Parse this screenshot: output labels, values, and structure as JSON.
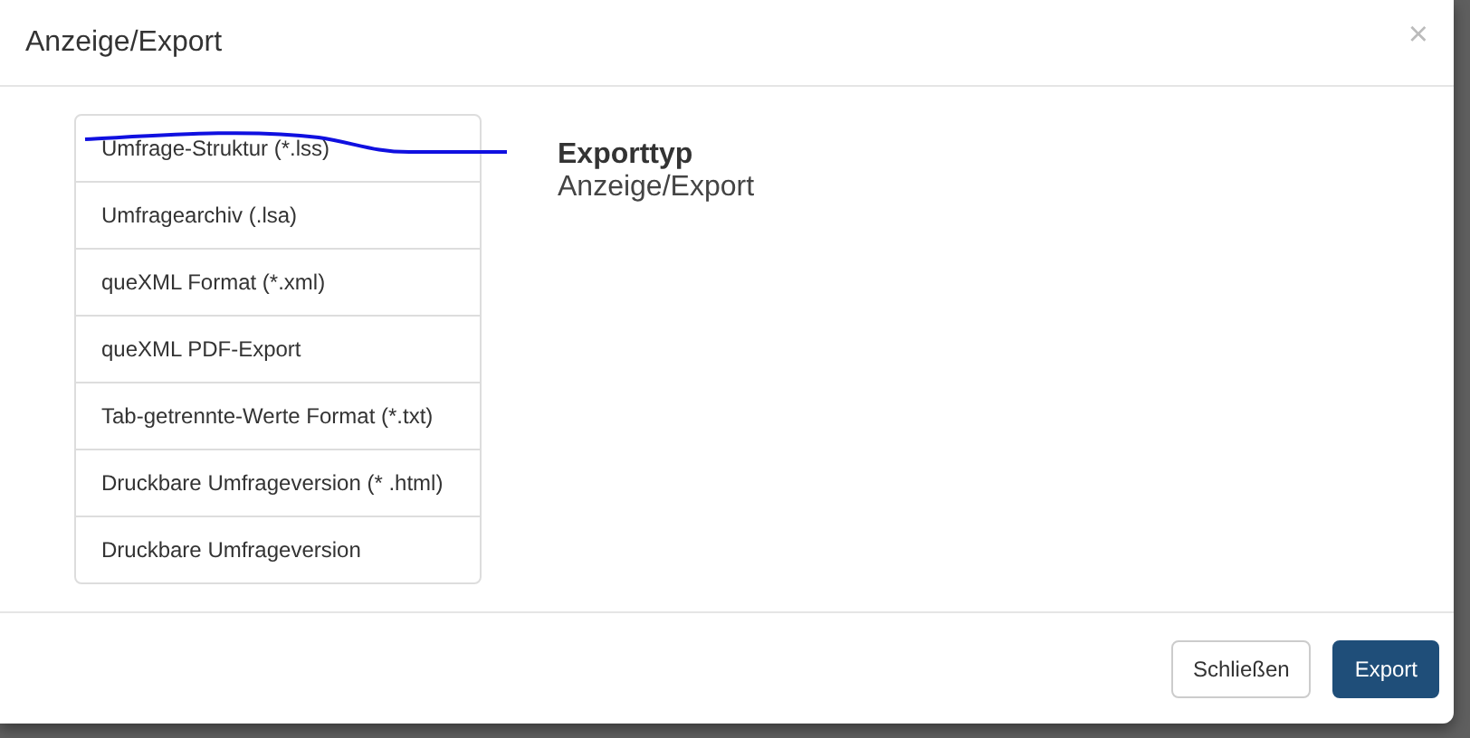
{
  "dialog": {
    "title": "Anzeige/Export",
    "close": "×"
  },
  "export_types": [
    {
      "label": "Umfrage-Struktur (*.lss)"
    },
    {
      "label": "Umfragearchiv (.lsa)"
    },
    {
      "label": "queXML Format (*.xml)"
    },
    {
      "label": "queXML PDF-Export"
    },
    {
      "label": "Tab-getrennte-Werte Format (*.txt)"
    },
    {
      "label": "Druckbare Umfrageversion (* .html)"
    },
    {
      "label": "Druckbare Umfrageversion"
    }
  ],
  "detail": {
    "heading": "Exporttyp",
    "value": "Anzeige/Export"
  },
  "buttons": [
    {
      "label": "Schließen",
      "kind": "secondary"
    },
    {
      "label": "Export",
      "kind": "primary"
    }
  ]
}
